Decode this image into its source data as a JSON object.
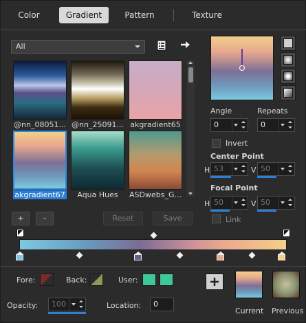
{
  "tabs": [
    {
      "label": "Color"
    },
    {
      "label": "Gradient",
      "active": true
    },
    {
      "label": "Pattern"
    },
    {
      "label": "Texture"
    }
  ],
  "category": {
    "selected": "All"
  },
  "icons": {
    "library": "library-icon",
    "export": "arrow-right-icon"
  },
  "gradients": [
    {
      "label": "@nn_08051...",
      "colors": [
        "#0d1a3f",
        "#2b5a9a",
        "#b8c6e6",
        "#5a4f8a",
        "#2a6e82",
        "#16263b"
      ]
    },
    {
      "label": "@nn_25091...",
      "colors": [
        "#20190f",
        "#c6c1a9",
        "#ffffff",
        "#b59a5c",
        "#1c1108"
      ]
    },
    {
      "label": "akgradient65",
      "colors": [
        "#c7aec9",
        "#d9a4ae",
        "#eaa3a6"
      ]
    },
    {
      "label": "akgradient67",
      "colors": [
        "#f2cf8a",
        "#e7a78f",
        "#7e6f96",
        "#6d9dbd",
        "#7fc9df"
      ],
      "selected": true
    },
    {
      "label": "Aqua Hues",
      "colors": [
        "#a8dccb",
        "#3a9a8c",
        "#1d4d52",
        "#0f2a33"
      ]
    },
    {
      "label": "ASDwebs_G...",
      "colors": [
        "#4f9a8e",
        "#b39b6d",
        "#d3854f",
        "#8a4a38"
      ]
    }
  ],
  "buttons": {
    "add": "+",
    "remove": "-",
    "reset": "Reset",
    "save": "Save"
  },
  "angle": {
    "label": "Angle",
    "value": "0"
  },
  "repeats": {
    "label": "Repeats",
    "value": "0"
  },
  "invert": {
    "label": "Invert",
    "checked": false
  },
  "center_point": {
    "label": "Center Point",
    "h_label": "H",
    "h": "53",
    "v_label": "V",
    "v": "50"
  },
  "focal_point": {
    "label": "Focal Point",
    "h_label": "H",
    "h": "50",
    "v_label": "V",
    "v": "50"
  },
  "link": {
    "label": "Link",
    "checked": false
  },
  "stops": {
    "color_stops": [
      "#7fc8df",
      "#6b5f8a",
      "#e8a88e",
      "#f3d08a"
    ],
    "positions": [
      0,
      45,
      76,
      100
    ]
  },
  "fore": {
    "label": "Fore:",
    "color": "#7a2a2a"
  },
  "back": {
    "label": "Back:",
    "color": "#8a9a5a"
  },
  "user": {
    "label": "User:",
    "colors": [
      "#3ec79a",
      "#3ec79a"
    ]
  },
  "opacity": {
    "label": "Opacity:",
    "value": "100"
  },
  "location": {
    "label": "Location:",
    "value": "0"
  },
  "current": {
    "label": "Current"
  },
  "previous": {
    "label": "Previous"
  }
}
